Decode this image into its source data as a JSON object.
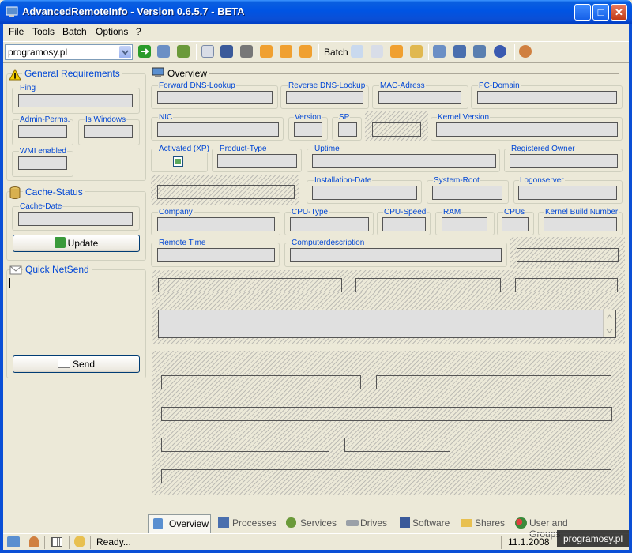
{
  "window": {
    "title": "AdvancedRemoteInfo - Version 0.6.5.7 - BETA",
    "controls": {
      "minimize": "_",
      "maximize": "□",
      "close": "✕"
    }
  },
  "menu": [
    "File",
    "Tools",
    "Batch",
    "Options",
    "?"
  ],
  "toolbar": {
    "server_value": "programosy.pl",
    "batch_label": "Batch"
  },
  "left": {
    "general": {
      "title": "General Requirements",
      "ping": "Ping",
      "admin_perms": "Admin-Perms.",
      "is_windows": "Is Windows",
      "wmi_enabled": "WMI enabled"
    },
    "cache": {
      "title": "Cache-Status",
      "cache_date": "Cache-Date",
      "update_label": "Update"
    },
    "netsend": {
      "title": "Quick NetSend",
      "send_label": "Send"
    }
  },
  "overview": {
    "title": "Overview",
    "labels": {
      "forward_dns": "Forward DNS-Lookup",
      "reverse_dns": "Reverse DNS-Lookup",
      "mac": "MAC-Adress",
      "pc_domain": "PC-Domain",
      "nic": "NIC",
      "version": "Version",
      "sp": "SP",
      "kernel_version": "Kernel Version",
      "activated": "Activated (XP)",
      "product_type": "Product-Type",
      "uptime": "Uptime",
      "registered_owner": "Registered Owner",
      "installation_date": "Installation-Date",
      "system_root": "System-Root",
      "logonserver": "Logonserver",
      "company": "Company",
      "cpu_type": "CPU-Type",
      "cpu_speed": "CPU-Speed",
      "ram": "RAM",
      "cpus": "CPUs",
      "kernel_build": "Kernel Build Number",
      "remote_time": "Remote Time",
      "computerdescription": "Computerdescription"
    }
  },
  "tabs": [
    "Overview",
    "Processes",
    "Services",
    "Drives",
    "Software",
    "Shares",
    "User and Groups"
  ],
  "status": {
    "text": "Ready...",
    "date": "11.1.2008",
    "watermark": "programosy.pl"
  },
  "colors": {
    "accent": "#0046d5",
    "title_bar": "#0054e3",
    "group_label": "#0046d5"
  }
}
